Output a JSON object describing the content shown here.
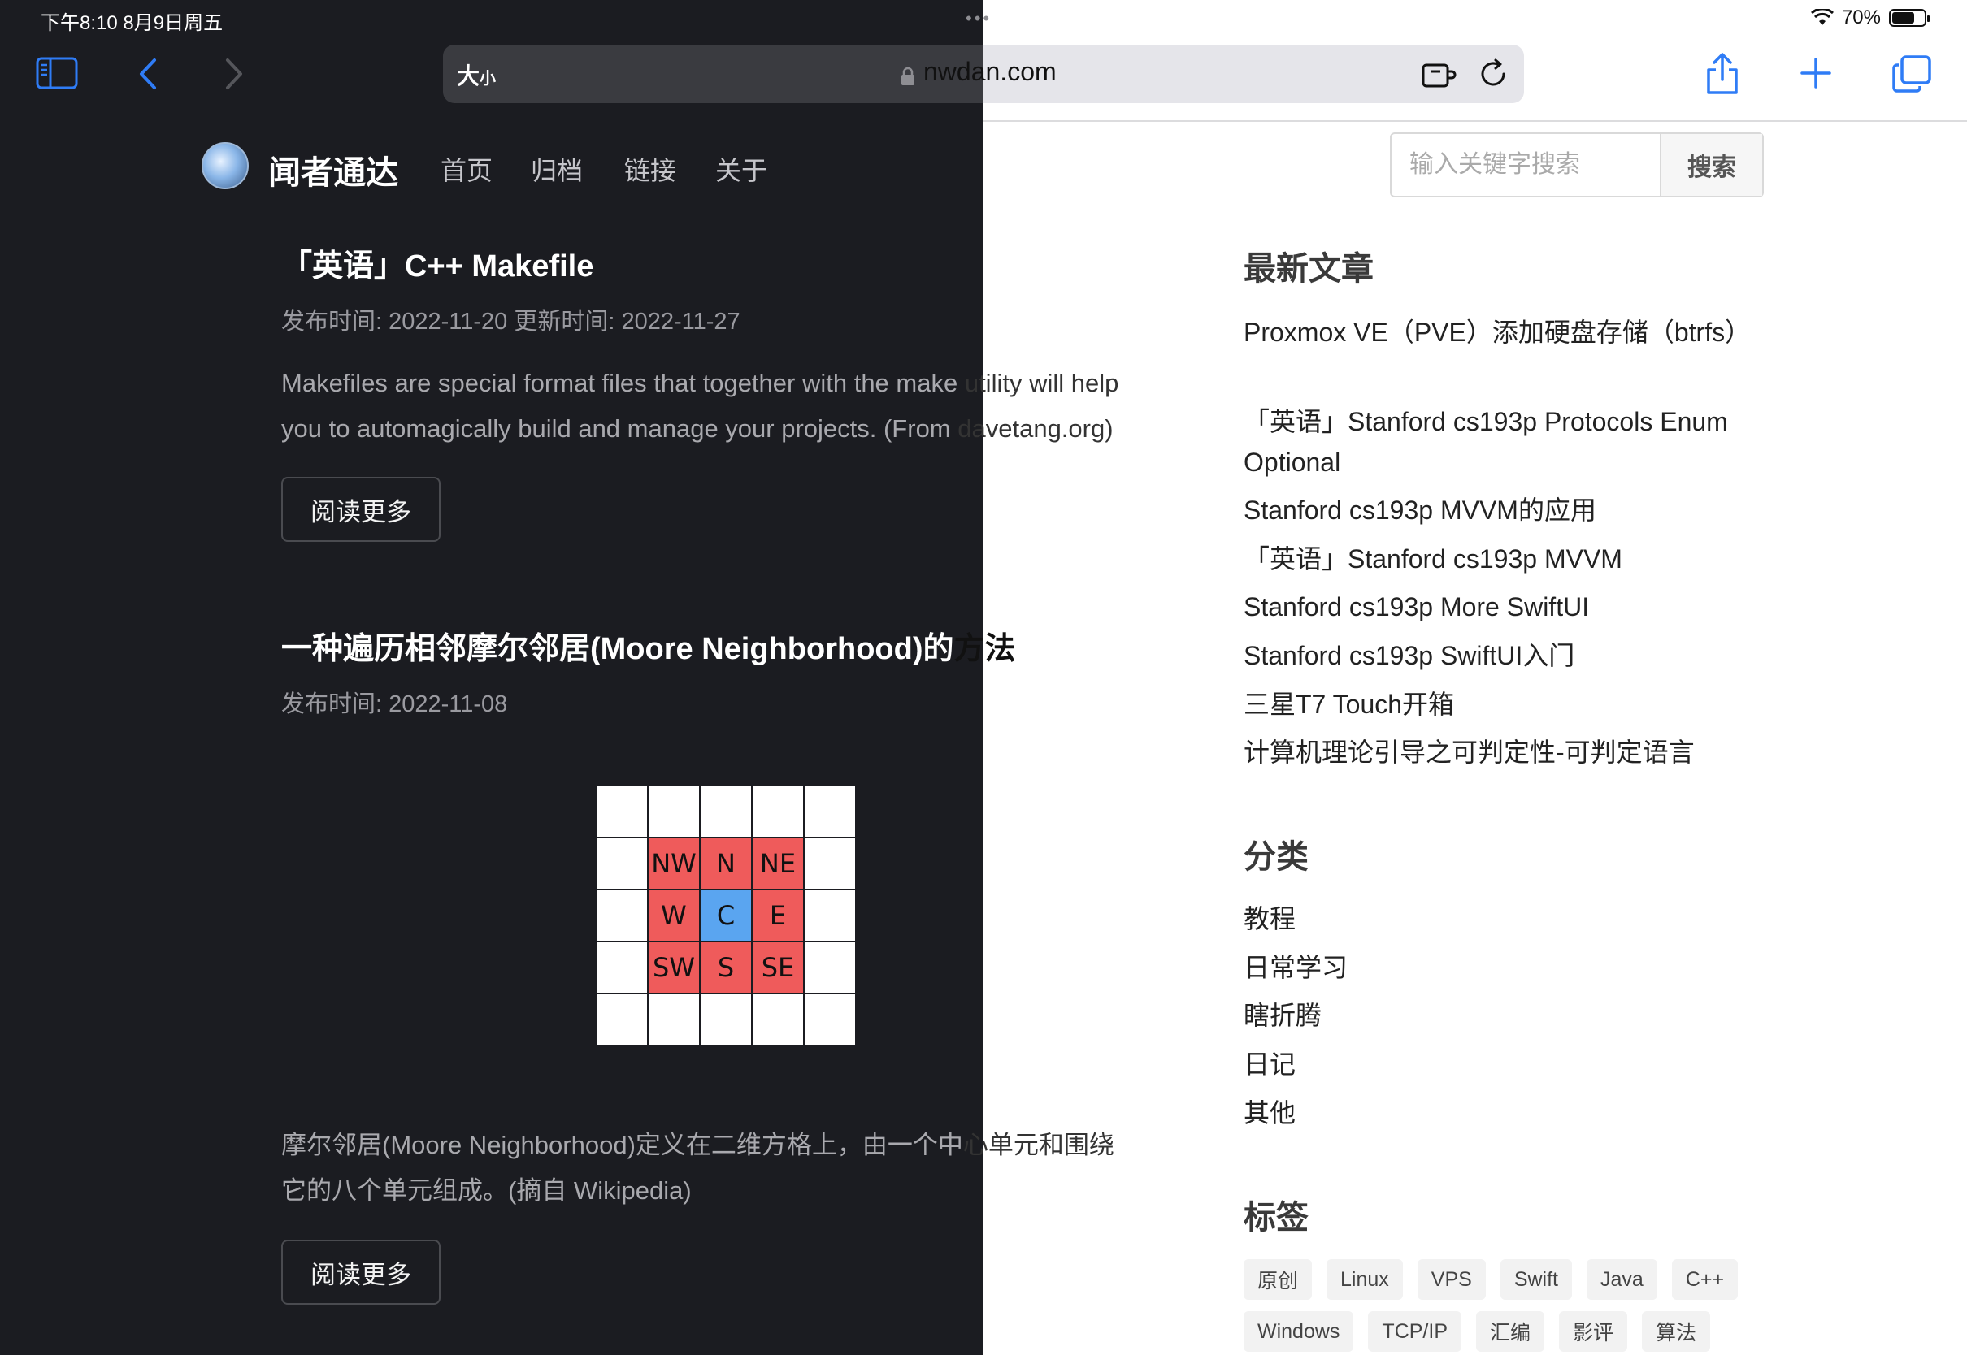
{
  "status_bar": {
    "time": "下午8:10   8月9日周五",
    "battery": "70%",
    "battery_level": 0.7
  },
  "toolbar": {
    "sidebar_icon": "sidebar-icon",
    "back_icon": "chevron-left-icon",
    "forward_icon": "chevron-right-icon",
    "text_size_label": "大",
    "text_size_small": "小",
    "domain": "nwdan.com",
    "extension_icon": "puzzle-icon",
    "reload_icon": "reload-icon",
    "share_icon": "share-icon",
    "new_tab_icon": "plus-icon",
    "tabs_icon": "tabs-icon"
  },
  "site": {
    "title": "闻者通达",
    "nav": [
      "首页",
      "归档",
      "链接",
      "关于"
    ],
    "search_placeholder": "输入关键字搜索",
    "search_button": "搜索"
  },
  "articles": [
    {
      "title_dark": "「英语」C++ Makefile",
      "title_light": "",
      "meta": "发布时间: 2022-11-20   更新时间: 2022-11-27",
      "summary_lines": [
        {
          "dark": "Makefiles are special format files that together with the make",
          "light": " utility will help"
        },
        {
          "dark": "you to automagically build and manage your projects. (From",
          "light": " davetang.org)"
        }
      ],
      "read_more": "阅读更多"
    },
    {
      "title_dark": "一种遍历相邻摩尔邻居(Moore Neighborhood)的",
      "title_light": "方法",
      "meta": "发布时间: 2022-11-08",
      "grid": [
        [
          "",
          "",
          "",
          "",
          ""
        ],
        [
          "",
          "NW",
          "N",
          "NE",
          ""
        ],
        [
          "",
          "W",
          "C",
          "E",
          ""
        ],
        [
          "",
          "SW",
          "S",
          "SE",
          ""
        ],
        [
          "",
          "",
          "",
          "",
          ""
        ]
      ],
      "summary_lines": [
        {
          "dark": "摩尔邻居(Moore Neighborhood)定义在二维方格上，由一个中",
          "light": "心单元和围绕"
        },
        {
          "dark": "它的八个单元组成。(摘自 Wikipedia)",
          "light": ""
        }
      ],
      "read_more": "阅读更多"
    }
  ],
  "sidebar": {
    "recent_heading": "最新文章",
    "recent": [
      "Proxmox VE（PVE）添加硬盘存储（btrfs）",
      "「英语」Stanford cs193p Protocols Enum Optional",
      "Stanford cs193p MVVM的应用",
      "「英语」Stanford cs193p MVVM",
      "Stanford cs193p More SwiftUI",
      "Stanford cs193p SwiftUI入门",
      "三星T7 Touch开箱",
      "计算机理论引导之可判定性-可判定语言"
    ],
    "category_heading": "分类",
    "categories": [
      "教程",
      "日常学习",
      "瞎折腾",
      "日记",
      "其他"
    ],
    "tag_heading": "标签",
    "tags": [
      "原创",
      "Linux",
      "VPS",
      "Swift",
      "Java",
      "C++",
      "Windows",
      "TCP/IP",
      "汇编",
      "影评",
      "算法"
    ]
  },
  "colors": {
    "dark_bg": "#1b1c21",
    "accent_blue": "#2f7cf6",
    "grid_red": "#ef5b5b",
    "grid_blue": "#5aa5f0"
  }
}
